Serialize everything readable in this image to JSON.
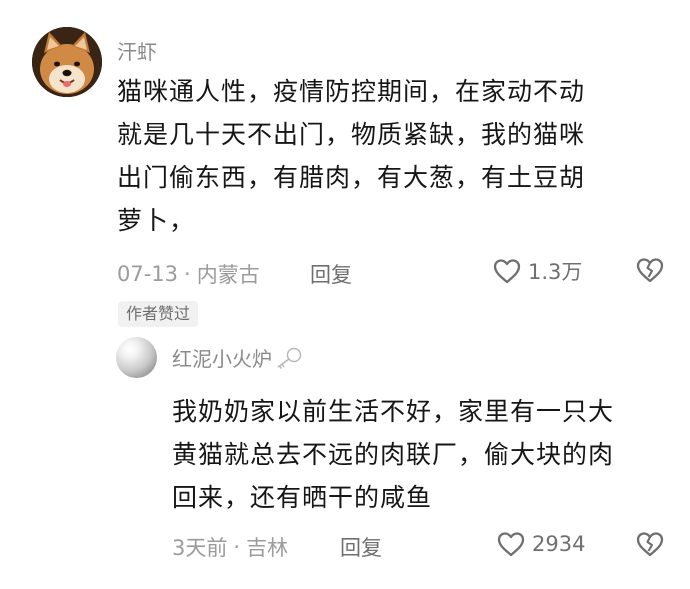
{
  "comment": {
    "username": "汗虾",
    "lines": [
      "猫咪通人性，疫情防控期间，在家动不动",
      "就是几十天不出门，物质紧缺，我的猫咪",
      "出门偷东西，有腊肉，有大葱，有土豆胡",
      "萝卜，"
    ],
    "date": "07-13",
    "location": "内蒙古",
    "reply_label": "回复",
    "likes": "1.3万",
    "badge": "作者赞过"
  },
  "reply": {
    "username": "红泥小火炉",
    "lines": [
      "我奶奶家以前生活不好，家里有一只大",
      "黄猫就总去不远的肉联厂，偷大块的肉",
      "回来，还有晒干的咸鱼"
    ],
    "date": "3天前",
    "location": "吉林",
    "reply_label": "回复",
    "likes": "2934"
  },
  "icons": {
    "like": "heart-outline-icon",
    "dislike": "broken-heart-icon",
    "username_decoration": "key-icon"
  },
  "colors": {
    "text": "#161616",
    "username": "#8a8a8a",
    "meta": "#9b9b9b",
    "badge_bg": "#f1f1f1"
  }
}
